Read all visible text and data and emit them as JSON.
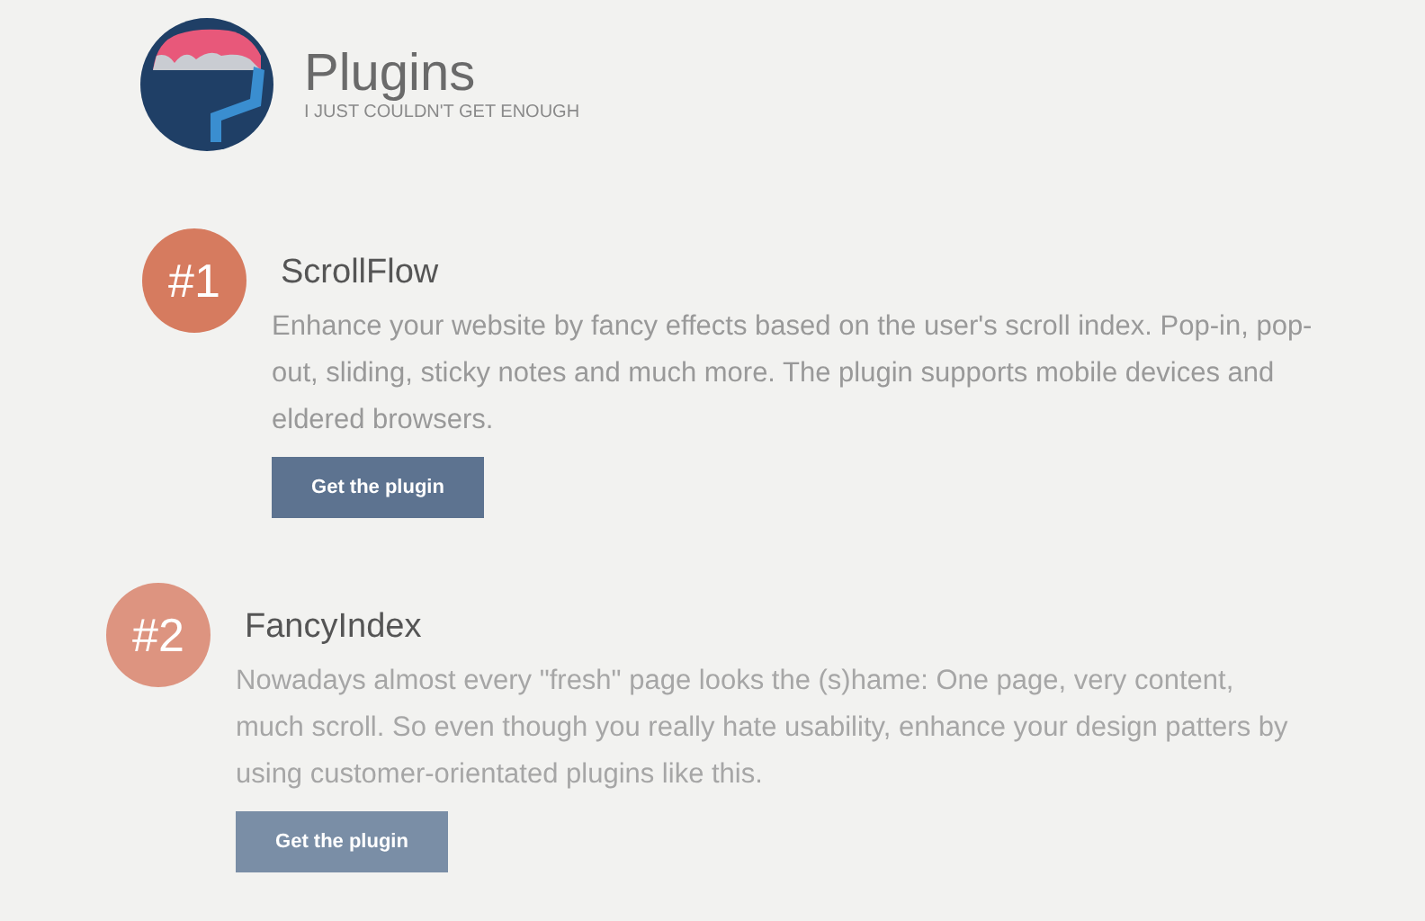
{
  "header": {
    "title": "Plugins",
    "subtitle": "I JUST COULDN'T GET ENOUGH"
  },
  "plugins": [
    {
      "number": "#1",
      "name": "ScrollFlow",
      "description": "Enhance your website by fancy effects based on the user's scroll index. Pop-in, pop-out, sliding, sticky notes and much more. The plugin supports mobile devices and eldered browsers.",
      "button": "Get the plugin",
      "faded": false
    },
    {
      "number": "#2",
      "name": "FancyIndex",
      "description": "Nowadays almost every \"fresh\" page looks the (s)hame: One page, very content, much scroll. So even though you really hate usability, enhance your design patters by using customer-orientated plugins like this.",
      "button": "Get the plugin",
      "faded": true
    }
  ]
}
